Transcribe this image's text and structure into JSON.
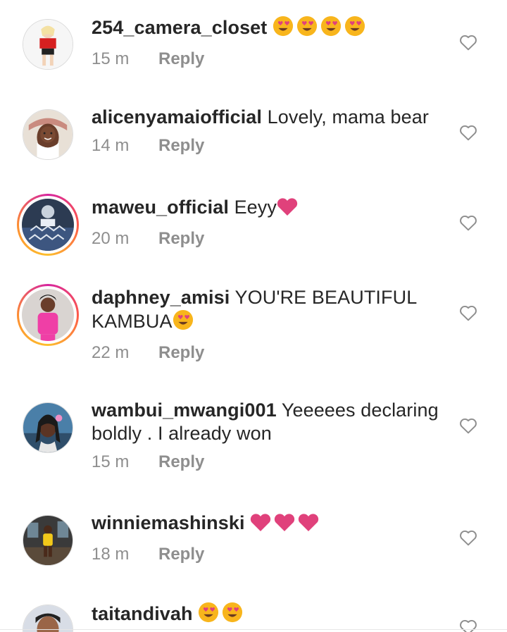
{
  "comments": [
    {
      "username": "254_camera_closet",
      "text": "",
      "emoji": [
        "smiling-heart-eyes",
        "smiling-heart-eyes",
        "smiling-heart-eyes",
        "smiling-heart-eyes"
      ],
      "time": "15 m",
      "reply": "Reply"
    },
    {
      "username": "alicenyamaiofficial",
      "text": "Lovely, mama bear",
      "emoji": [],
      "time": "14 m",
      "reply": "Reply"
    },
    {
      "username": "maweu_official",
      "text": "Eeyy",
      "emoji": [
        "pink-heart"
      ],
      "time": "20 m",
      "reply": "Reply"
    },
    {
      "username": "daphney_amisi",
      "text": "YOU'RE BEAUTIFUL KAMBUA",
      "emoji": [
        "smiling-heart-eyes"
      ],
      "time": "22 m",
      "reply": "Reply"
    },
    {
      "username": "wambui_mwangi001",
      "text": "Yeeeees declaring boldly . I already won",
      "emoji": [],
      "time": "15 m",
      "reply": "Reply"
    },
    {
      "username": "winniemashinski",
      "text": "",
      "emoji": [
        "pink-heart",
        "pink-heart",
        "pink-heart"
      ],
      "time": "18 m",
      "reply": "Reply"
    },
    {
      "username": "taitandivah",
      "text": "",
      "emoji": [
        "smiling-heart-eyes",
        "smiling-heart-eyes"
      ],
      "time": "",
      "reply": ""
    }
  ],
  "icons": {
    "like": "heart-outline-icon"
  },
  "colors": {
    "text": "#262626",
    "meta": "#8e8e8e",
    "emoji_heart": "#e0417b",
    "emoji_face": "#f8b51c"
  }
}
